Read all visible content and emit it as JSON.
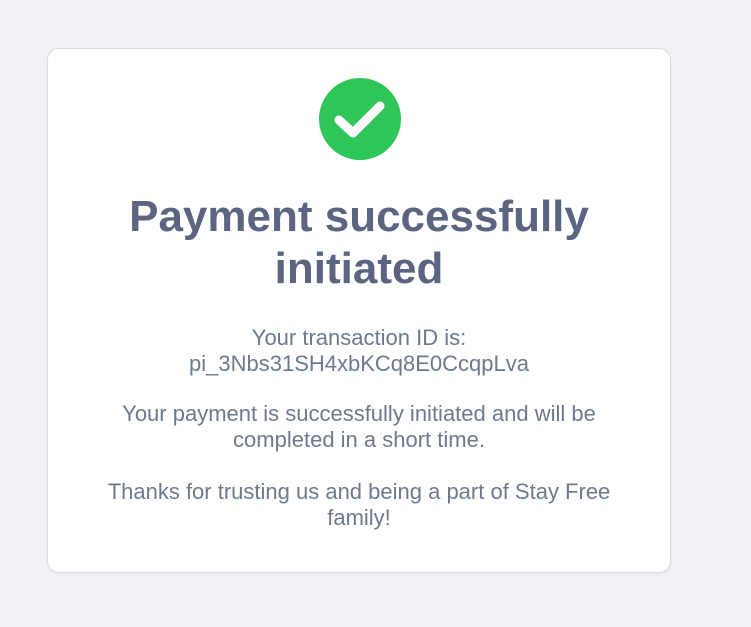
{
  "success_card": {
    "icon": "check-circle-icon",
    "icon_color": "#2fc658",
    "title": "Payment successfully initiated",
    "transaction_label": "Your transaction ID is:",
    "transaction_id": "pi_3Nbs31SH4xbKCq8E0CcqpLva",
    "message": "Your payment is successfully initiated and will be completed in a short time.",
    "thanks": "Thanks for trusting us and being a part of Stay Free family!"
  }
}
